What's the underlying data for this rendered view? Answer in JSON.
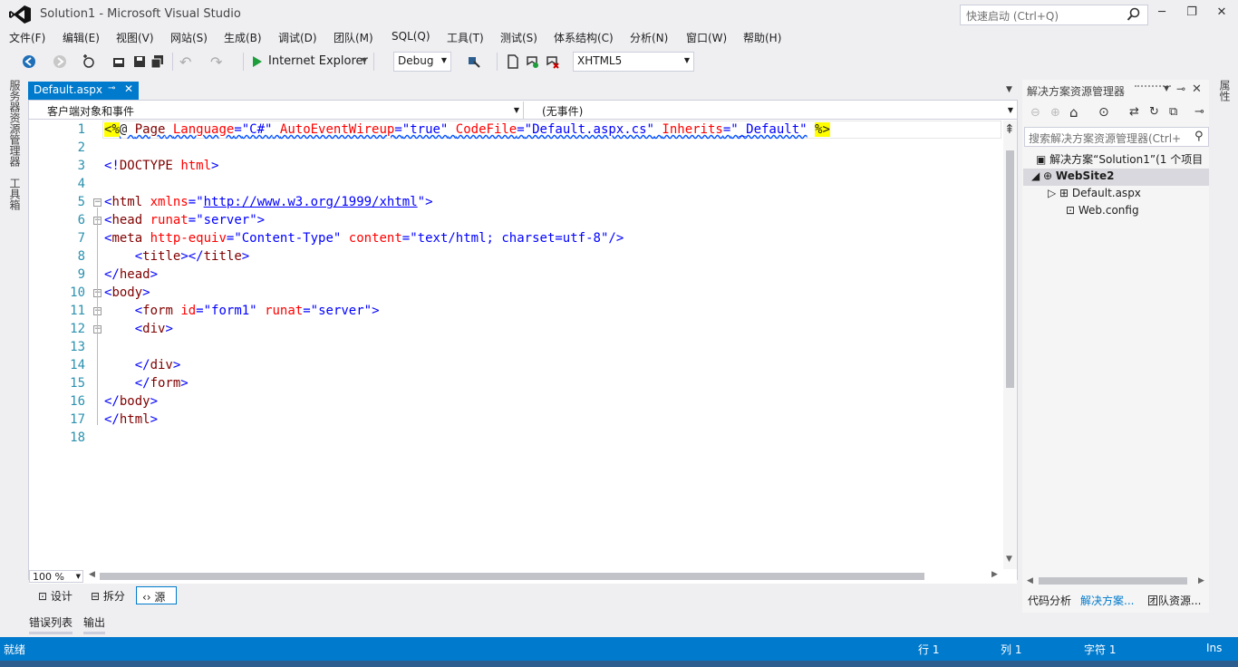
{
  "window": {
    "title": "Solution1 - Microsoft Visual Studio",
    "quick_launch_placeholder": "快速启动 (Ctrl+Q)"
  },
  "menu": [
    "文件(F)",
    "编辑(E)",
    "视图(V)",
    "网站(S)",
    "生成(B)",
    "调试(D)",
    "团队(M)",
    "SQL(Q)",
    "工具(T)",
    "测试(S)",
    "体系结构(C)",
    "分析(N)",
    "窗口(W)",
    "帮助(H)"
  ],
  "toolbar": {
    "run_target": "Internet Explorer",
    "configuration": "Debug",
    "schema": "XHTML5"
  },
  "left_strip": {
    "server_explorer": "服务器资源管理器",
    "toolbox": "工具箱"
  },
  "right_strip": {
    "properties": "属性"
  },
  "editor": {
    "tab_title": "Default.aspx",
    "nav_left": "客户端对象和事件",
    "nav_right": "(无事件)",
    "zoom": "100 %",
    "lines": [
      "1",
      "2",
      "3",
      "4",
      "5",
      "6",
      "7",
      "8",
      "9",
      "10",
      "11",
      "12",
      "13",
      "14",
      "15",
      "16",
      "17",
      "18"
    ]
  },
  "view_buttons": {
    "design": "设计",
    "split": "拆分",
    "source": "源"
  },
  "bottom_tabs": [
    "错误列表",
    "输出"
  ],
  "solution_explorer": {
    "title": "解决方案资源管理器",
    "search_placeholder": "搜索解决方案资源管理器(Ctrl+",
    "solution": "解决方案“Solution1”(1 个项目",
    "website": "WebSite2",
    "items": [
      "Default.aspx",
      "Web.config"
    ],
    "bottom_tabs": [
      "代码分析",
      "解决方案...",
      "团队资源..."
    ]
  },
  "status": {
    "ready": "就绪",
    "row": "行 1",
    "col": "列 1",
    "char": "字符 1",
    "mode": "Ins"
  },
  "colors": {
    "accent": "#007ACC",
    "line_numbers": "#2B91AF"
  }
}
